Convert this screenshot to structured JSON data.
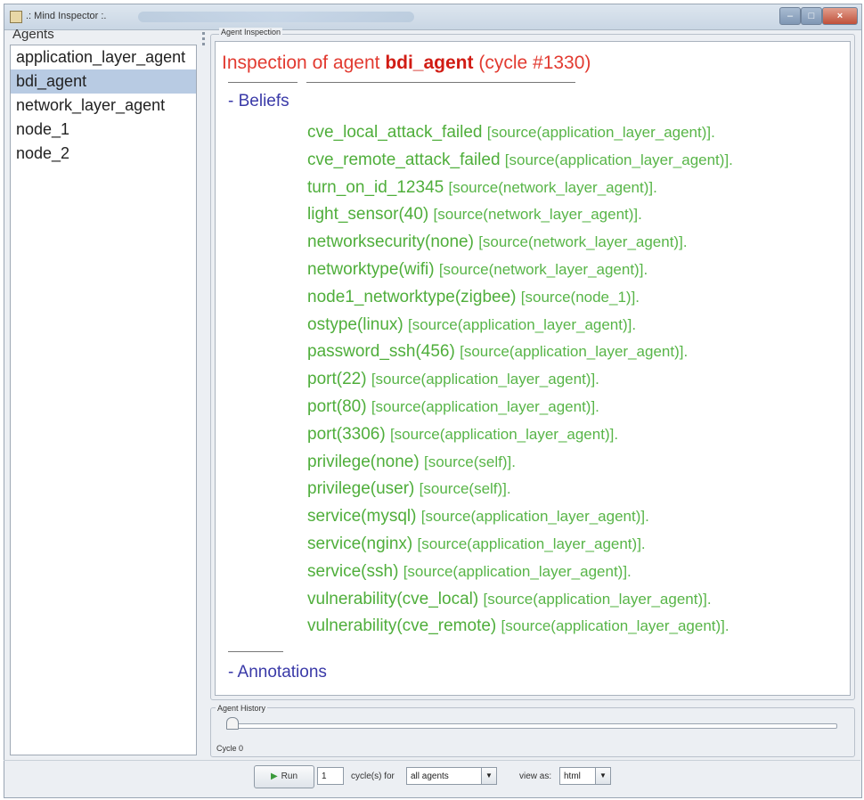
{
  "window": {
    "title": ".: Mind Inspector :."
  },
  "agents_panel": {
    "header": "Agents",
    "items": [
      "application_layer_agent",
      "bdi_agent",
      "network_layer_agent",
      "node_1",
      "node_2"
    ],
    "selected": "bdi_agent"
  },
  "inspection": {
    "legend": "Agent Inspection",
    "title_prefix": "Inspection of agent",
    "agent_name": "bdi_agent",
    "cycle": "(cycle #1330)",
    "beliefs_label": "- Beliefs",
    "annotations_label": "- Annotations",
    "beliefs": [
      {
        "term": "cve_local_attack_failed",
        "source": "[source(application_layer_agent)]."
      },
      {
        "term": "cve_remote_attack_failed",
        "source": "[source(application_layer_agent)]."
      },
      {
        "term": "turn_on_id_12345",
        "source": "[source(network_layer_agent)]."
      },
      {
        "term": "light_sensor(40)",
        "source": "[source(network_layer_agent)]."
      },
      {
        "term": "networksecurity(none)",
        "source": "[source(network_layer_agent)]."
      },
      {
        "term": "networktype(wifi)",
        "source": "[source(network_layer_agent)]."
      },
      {
        "term": "node1_networktype(zigbee)",
        "source": "[source(node_1)]."
      },
      {
        "term": "ostype(linux)",
        "source": "[source(application_layer_agent)]."
      },
      {
        "term": "password_ssh(456)",
        "source": "[source(application_layer_agent)]."
      },
      {
        "term": "port(22)",
        "source": "[source(application_layer_agent)]."
      },
      {
        "term": "port(80)",
        "source": "[source(application_layer_agent)]."
      },
      {
        "term": "port(3306)",
        "source": "[source(application_layer_agent)]."
      },
      {
        "term": "privilege(none)",
        "source": "[source(self)]."
      },
      {
        "term": "privilege(user)",
        "source": "[source(self)]."
      },
      {
        "term": "service(mysql)",
        "source": "[source(application_layer_agent)]."
      },
      {
        "term": "service(nginx)",
        "source": "[source(application_layer_agent)]."
      },
      {
        "term": "service(ssh)",
        "source": "[source(application_layer_agent)]."
      },
      {
        "term": "vulnerability(cve_local)",
        "source": "[source(application_layer_agent)]."
      },
      {
        "term": "vulnerability(cve_remote)",
        "source": "[source(application_layer_agent)]."
      }
    ]
  },
  "history": {
    "legend": "Agent History",
    "slider_label": "Cycle 0",
    "slider_value": 0
  },
  "toolbar": {
    "run_label": "Run",
    "cycles_value": "1",
    "cycles_for_label": "cycle(s) for",
    "agents_combo_value": "all agents",
    "view_as_label": "view as:",
    "view_combo_value": "html"
  },
  "colors": {
    "title_red": "#d11c14",
    "belief_green": "#4fae3b",
    "section_blue": "#3a3aa8",
    "selection": "#b8cbe3"
  },
  "icons": [
    "app-icon",
    "minimize-icon",
    "maximize-icon",
    "close-icon",
    "play-icon",
    "dropdown-arrow-icon"
  ]
}
